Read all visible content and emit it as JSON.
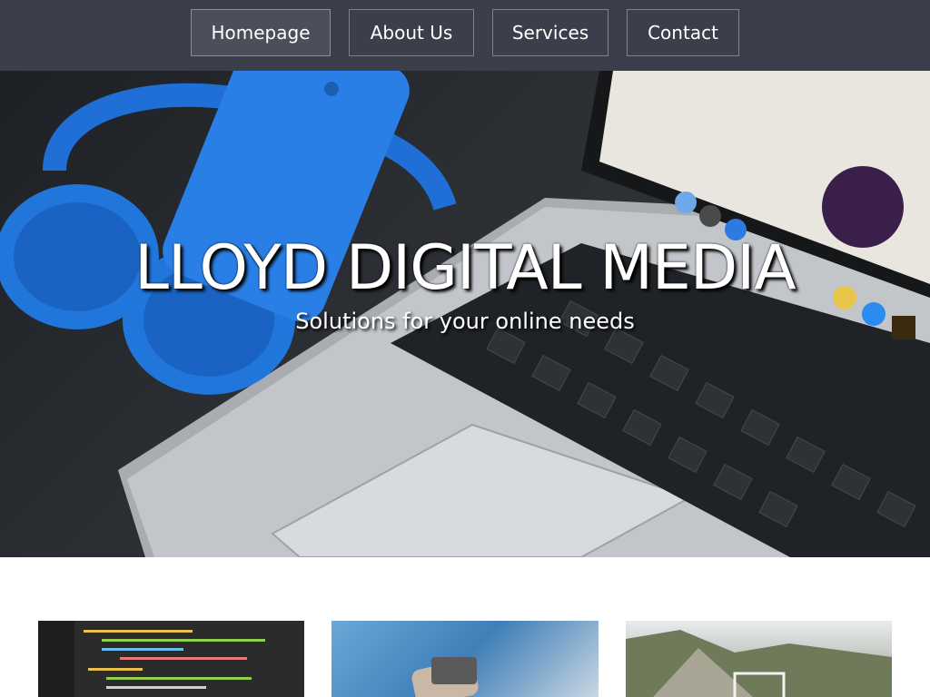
{
  "nav": {
    "items": [
      {
        "label": "Homepage",
        "active": true
      },
      {
        "label": "About Us",
        "active": false
      },
      {
        "label": "Services",
        "active": false
      },
      {
        "label": "Contact",
        "active": false
      }
    ]
  },
  "hero": {
    "title": "LLOYD DIGITAL MEDIA",
    "subtitle": "Solutions for your online needs",
    "image": "laptop-headphones-phone-photo"
  },
  "cards": [
    {
      "image": "code-editor-photo"
    },
    {
      "image": "hand-holding-phone-photo"
    },
    {
      "image": "cliff-landscape-photo"
    }
  ],
  "colors": {
    "nav_background": "#3b3f4b",
    "nav_border": "#7b808c",
    "accent_blue": "#1f6fd6"
  }
}
